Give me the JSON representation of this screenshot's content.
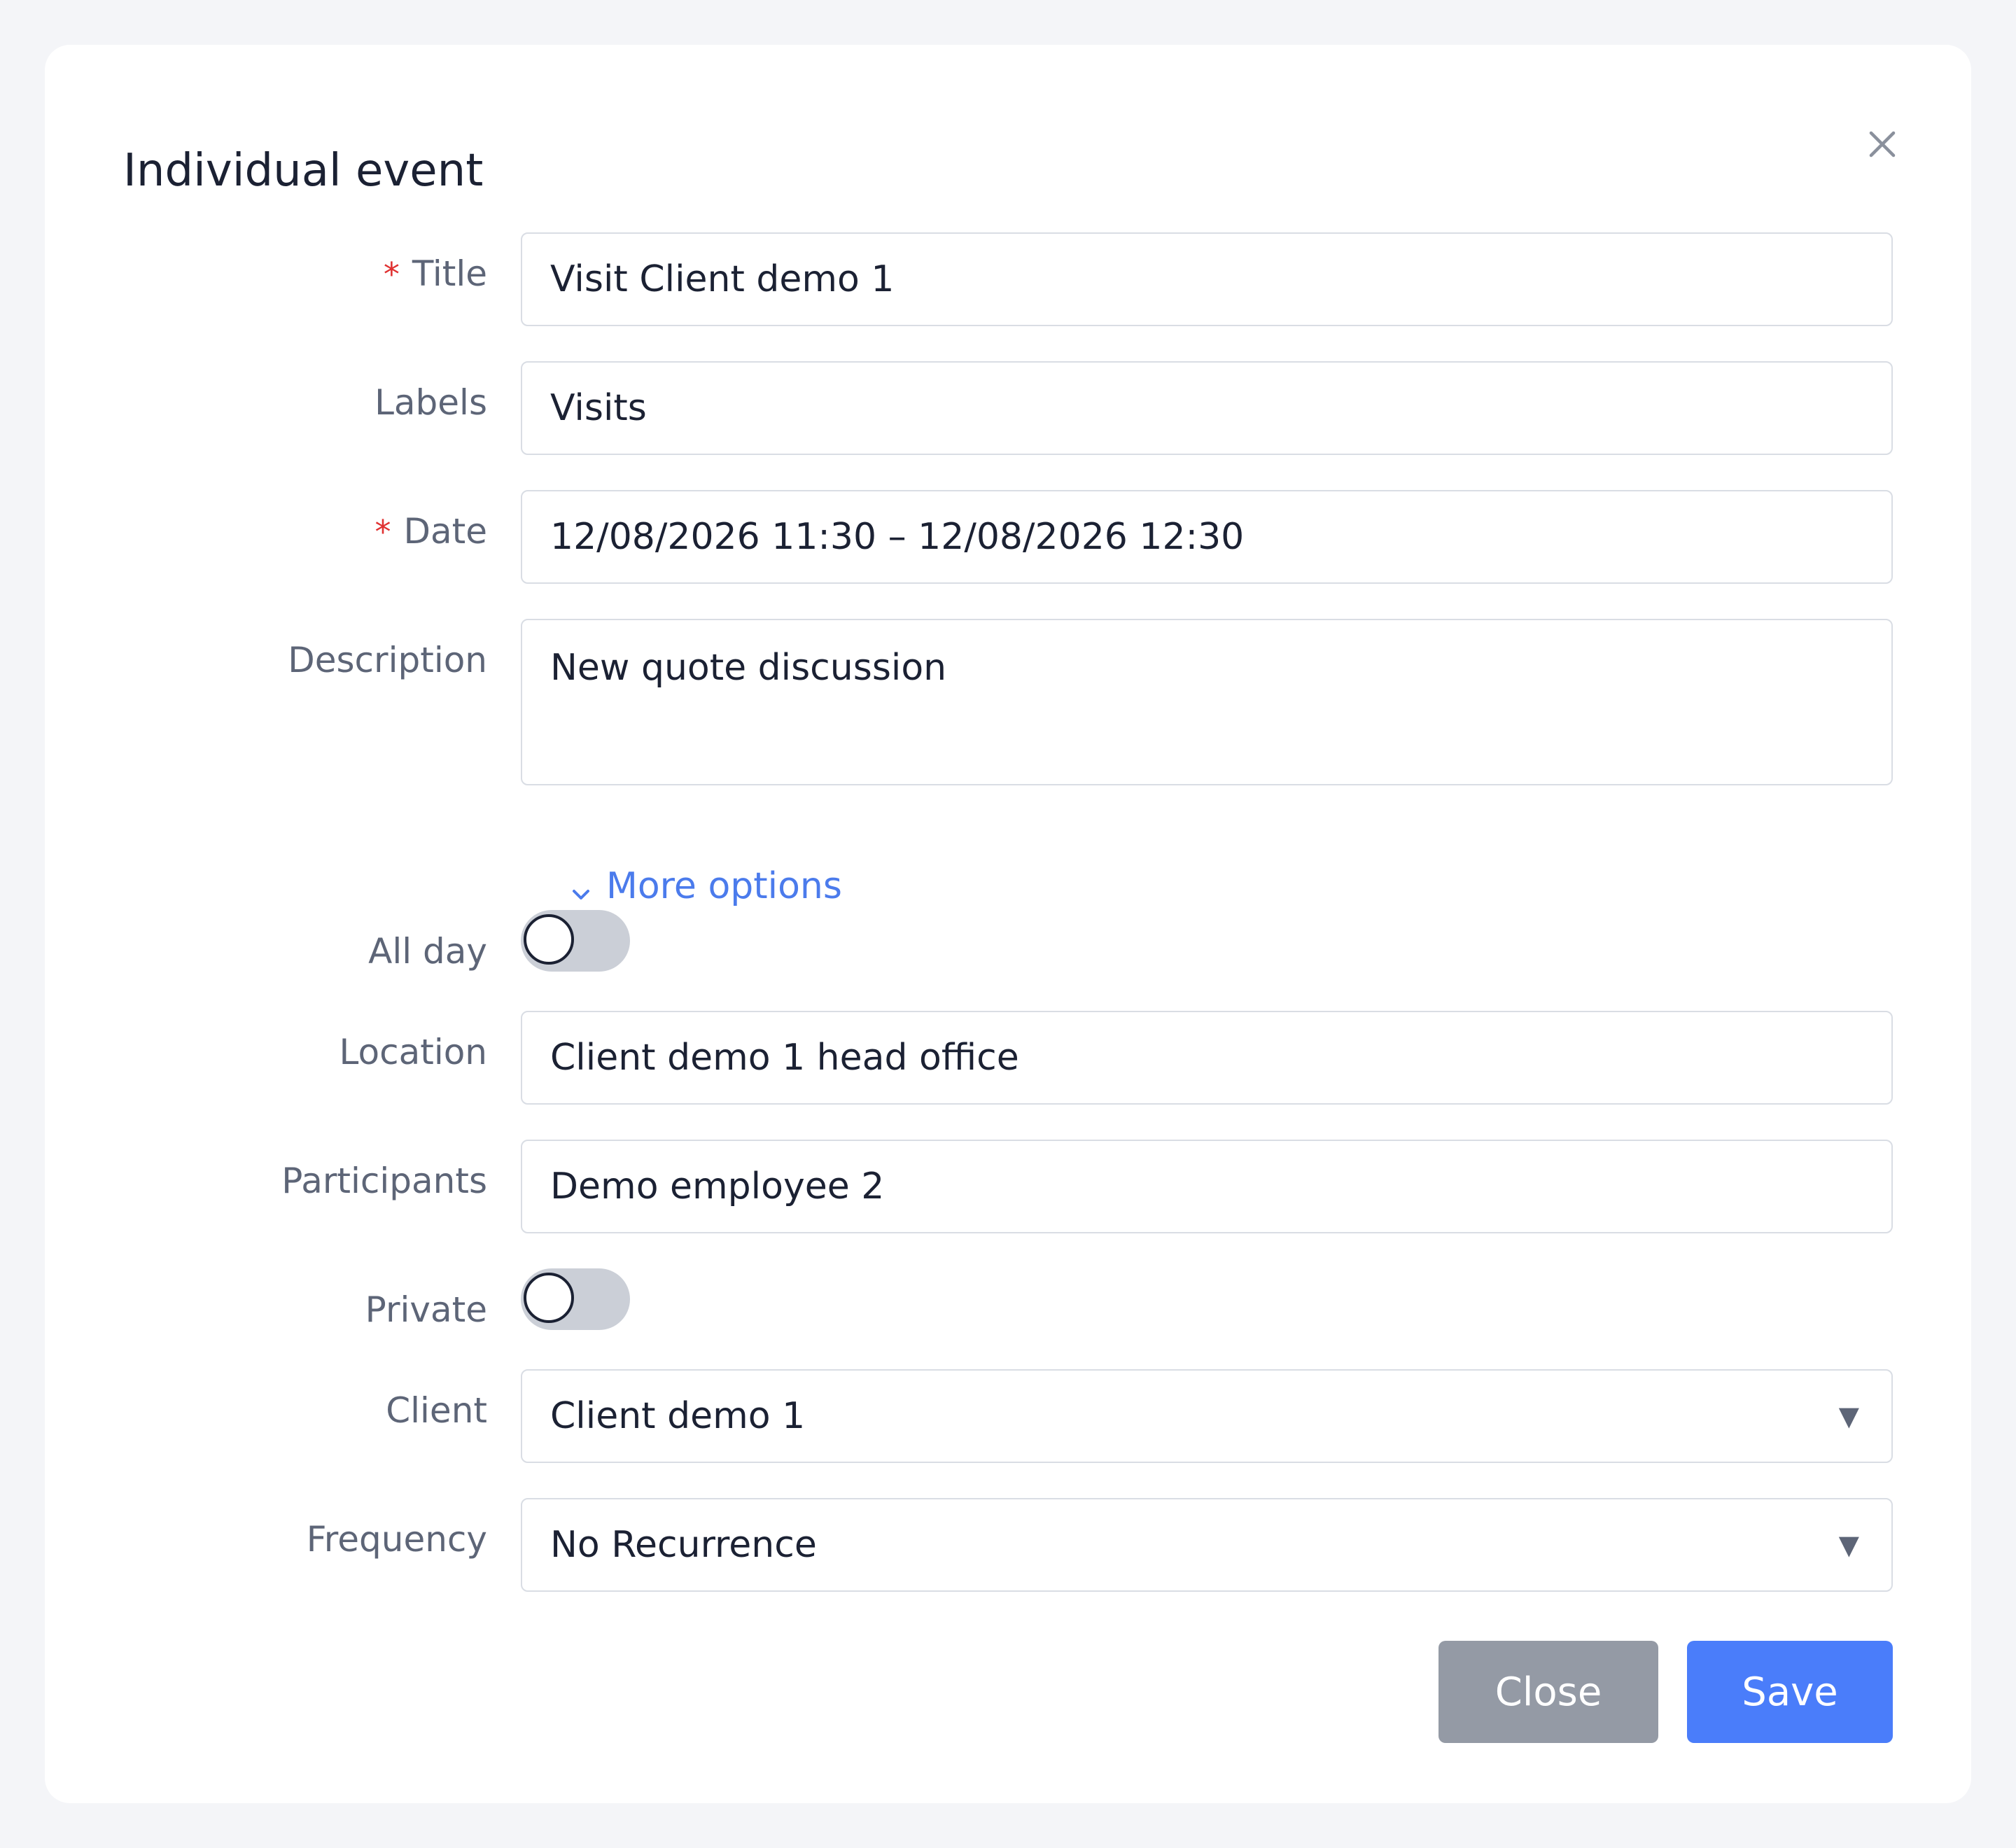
{
  "dialog": {
    "title": "Individual event"
  },
  "form": {
    "title": {
      "label": "Title",
      "required_mark": "*",
      "value": "Visit Client demo 1"
    },
    "labels": {
      "label": "Labels",
      "value": "Visits"
    },
    "date": {
      "label": "Date",
      "required_mark": "*",
      "value": "12/08/2026 11:30 – 12/08/2026 12:30"
    },
    "description": {
      "label": "Description",
      "value": "New quote discussion"
    },
    "more_options": {
      "label": "More options",
      "icon": "chevron-down-icon"
    },
    "all_day": {
      "label": "All day",
      "checked": false
    },
    "location": {
      "label": "Location",
      "value": "Client demo 1 head office"
    },
    "participants": {
      "label": "Participants",
      "value": "Demo employee 2"
    },
    "private": {
      "label": "Private",
      "checked": false
    },
    "client": {
      "label": "Client",
      "value": "Client demo 1",
      "caret": "▼"
    },
    "frequency": {
      "label": "Frequency",
      "value": "No Recurrence",
      "caret": "▼"
    }
  },
  "footer": {
    "close_label": "Close",
    "save_label": "Save"
  },
  "colors": {
    "primary": "#4a7dfa",
    "secondary": "#949aa5",
    "required": "#e03131",
    "link": "#4b7bec"
  }
}
